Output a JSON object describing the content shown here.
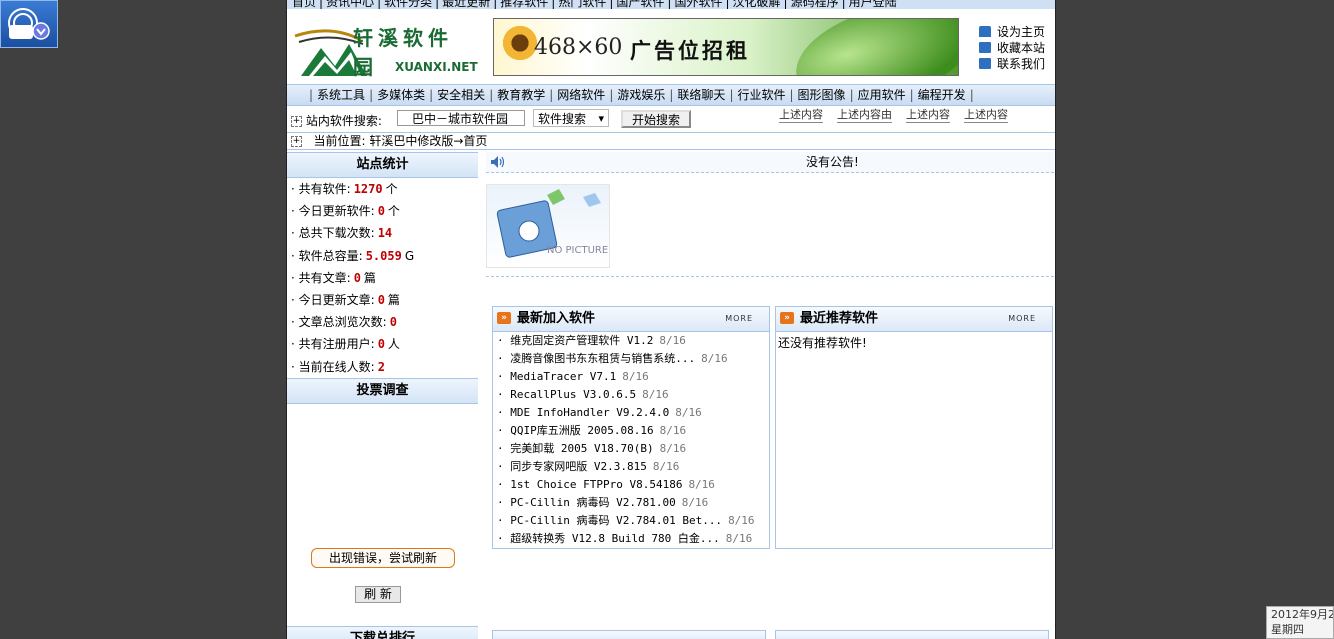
{
  "top_nav": [
    "首页",
    "资讯中心",
    "软件分类",
    "最近更新",
    "推荐软件",
    "热门软件",
    "国产软件",
    "国外软件",
    "汉化破解",
    "源码程序",
    "用户登陆"
  ],
  "logo": {
    "chinese": "轩溪软件园",
    "english": "XUANXI.NET"
  },
  "ad": {
    "size": "468×60",
    "text": "广告位招租"
  },
  "quick_links": [
    "设为主页",
    "收藏本站",
    "联系我们"
  ],
  "categories": [
    "系统工具",
    "多媒体类",
    "安全相关",
    "教育教学",
    "网络软件",
    "游戏娱乐",
    "联络聊天",
    "行业软件",
    "图形图像",
    "应用软件",
    "编程开发"
  ],
  "search": {
    "label": "站内软件搜索:",
    "input_value": "巴中－城市软件园",
    "select_value": "软件搜索",
    "button": "开始搜索",
    "tags": [
      "上述内容",
      "上述内容由",
      "上述内容",
      "上述内容"
    ]
  },
  "location": {
    "label": "当前位置:",
    "path": "轩溪巴中修改版→首页"
  },
  "site_stats": {
    "title": "站点统计",
    "items": [
      {
        "label": "共有软件:",
        "value": "1270",
        "unit": "个"
      },
      {
        "label": "今日更新软件:",
        "value": "0",
        "unit": "个"
      },
      {
        "label": "总共下载次数:",
        "value": "14",
        "unit": ""
      },
      {
        "label": "软件总容量:",
        "value": "5.059",
        "unit": "G"
      },
      {
        "label": "共有文章:",
        "value": "0",
        "unit": "篇"
      },
      {
        "label": "今日更新文章:",
        "value": "0",
        "unit": "篇"
      },
      {
        "label": "文章总浏览次数:",
        "value": "0",
        "unit": ""
      },
      {
        "label": "共有注册用户:",
        "value": "0",
        "unit": "人"
      },
      {
        "label": "当前在线人数:",
        "value": "2",
        "unit": ""
      }
    ]
  },
  "vote": {
    "title": "投票调查",
    "error_button": "出现错误，尝试刷新",
    "refresh_button": "刷 新"
  },
  "download_rank": {
    "title": "下载总排行"
  },
  "notice": {
    "text": "没有公告!"
  },
  "no_picture": "NO PICTURE",
  "latest_software": {
    "title": "最新加入软件",
    "more": "MORE",
    "items": [
      {
        "name": "维克固定资产管理软件 V1.2",
        "date": "8/16"
      },
      {
        "name": "凌腾音像图书东东租赁与销售系统...",
        "date": "8/16"
      },
      {
        "name": "MediaTracer V7.1",
        "date": "8/16"
      },
      {
        "name": "RecallPlus V3.0.6.5",
        "date": "8/16"
      },
      {
        "name": "MDE InfoHandler V9.2.4.0",
        "date": "8/16"
      },
      {
        "name": "QQIP库五洲版 2005.08.16",
        "date": "8/16"
      },
      {
        "name": "完美卸载 2005 V18.70(B)",
        "date": "8/16"
      },
      {
        "name": "同步专家网吧版 V2.3.815",
        "date": "8/16"
      },
      {
        "name": "1st Choice FTPPro V8.54186",
        "date": "8/16"
      },
      {
        "name": "PC-Cillin 病毒码 V2.781.00",
        "date": "8/16"
      },
      {
        "name": "PC-Cillin 病毒码 V2.784.01 Bet...",
        "date": "8/16"
      },
      {
        "name": "超级转换秀 V12.8 Build 780 白金...",
        "date": "8/16"
      }
    ]
  },
  "recommended_software": {
    "title": "最近推荐软件",
    "more": "MORE",
    "empty": "还没有推荐软件!"
  },
  "clock": {
    "date": "2012年9月2",
    "weekday": "星期四"
  },
  "colors": {
    "value_red": "#c00000",
    "panel_border": "#a8c4e6",
    "arrow_orange": "#e7731a"
  }
}
